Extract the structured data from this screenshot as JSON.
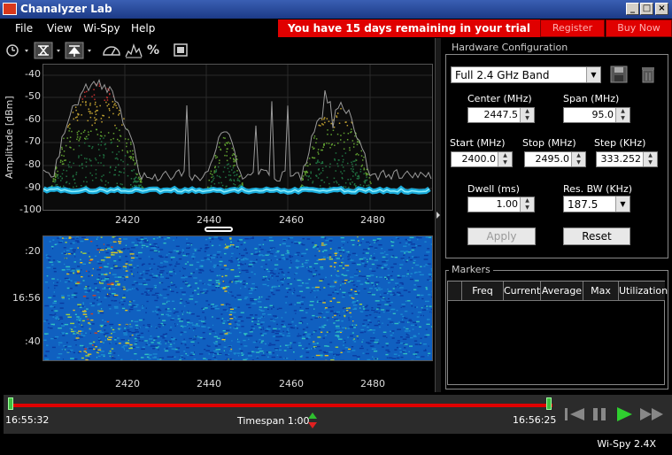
{
  "window": {
    "title": "Chanalyzer Lab",
    "controls": [
      "_",
      "□",
      "×"
    ]
  },
  "menu": [
    "File",
    "View",
    "Wi-Spy",
    "Help"
  ],
  "trial": {
    "banner": "You have 15 days remaining in your trial",
    "register_label": "Register",
    "buy_label": "Buy Now",
    "color": "#e00000"
  },
  "toolbar": {
    "icons": [
      "clock-icon",
      "filter-icon",
      "peak-icon",
      "gauge-icon",
      "spectrum-icon",
      "percent-icon",
      "window-icon"
    ],
    "percent_label": "%"
  },
  "spectrum": {
    "ylabel": "Amplitude [dBm]",
    "yticks": [
      "-40",
      "-50",
      "-60",
      "-70",
      "-80",
      "-90",
      "-100"
    ],
    "xticks": [
      "2420",
      "2440",
      "2460",
      "2480"
    ]
  },
  "waterfall": {
    "yticks": [
      ":20",
      "16:56",
      ":40"
    ],
    "xticks": [
      "2420",
      "2440",
      "2460",
      "2480"
    ]
  },
  "hardware": {
    "title": "Hardware Configuration",
    "band": "Full 2.4 GHz Band",
    "center_label": "Center (MHz)",
    "center_value": "2447.5",
    "span_label": "Span (MHz)",
    "span_value": "95.0",
    "start_label": "Start (MHz)",
    "start_value": "2400.0",
    "stop_label": "Stop (MHz)",
    "stop_value": "2495.0",
    "step_label": "Step (KHz)",
    "step_value": "333.252",
    "dwell_label": "Dwell (ms)",
    "dwell_value": "1.00",
    "resbw_label": "Res. BW (KHz)",
    "resbw_value": "187.5",
    "apply_label": "Apply",
    "reset_label": "Reset"
  },
  "markers": {
    "title": "Markers",
    "columns": [
      "",
      "Freq",
      "Current",
      "Average",
      "Max",
      "Utilization"
    ]
  },
  "timeline": {
    "start_time": "16:55:32",
    "end_time": "16:56:25",
    "timespan": "Timespan 1:00",
    "colors": {
      "track": "#e00000",
      "handle": "#3fbf3f"
    }
  },
  "status": {
    "device": "Wi-Spy 2.4X"
  }
}
